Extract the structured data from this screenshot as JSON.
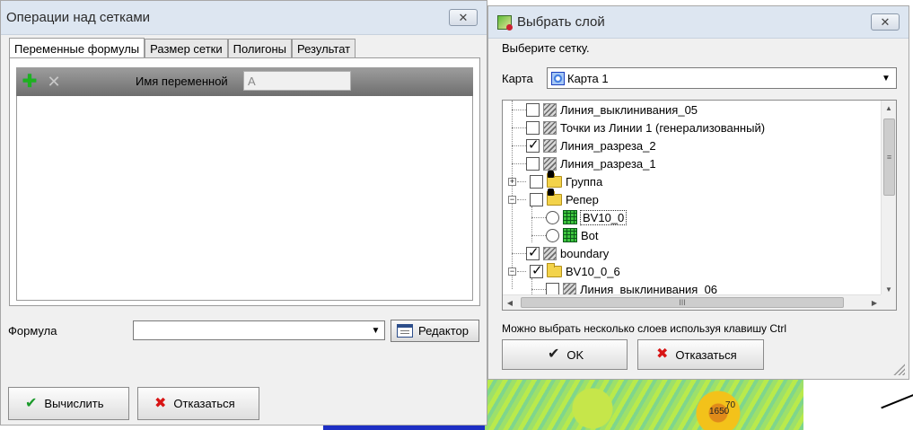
{
  "grid_window": {
    "title": "Операции над сетками",
    "close_label": "✕",
    "tabs": [
      {
        "label": "Переменные формулы"
      },
      {
        "label": "Размер сетки"
      },
      {
        "label": "Полигоны"
      },
      {
        "label": "Результат"
      }
    ],
    "variable_label": "Имя переменной",
    "variable_value": "A",
    "formula_label": "Формула",
    "formula_value": "",
    "editor_button": "Редактор",
    "calculate_button": "Вычислить",
    "cancel_button": "Отказаться"
  },
  "layer_window": {
    "title": "Выбрать слой",
    "close_label": "✕",
    "hint": "Выберите сетку.",
    "map_label": "Карта",
    "map_value": "Карта 1",
    "tree": [
      {
        "label": "Линия_выклинивания_05",
        "checked": false
      },
      {
        "label": "Точки из Линии 1 (генерализованный)",
        "checked": false
      },
      {
        "label": "Линия_разреза_2",
        "checked": true
      },
      {
        "label": "Линия_разреза_1",
        "checked": false
      },
      {
        "label": "Группа",
        "checked": false
      },
      {
        "label": "Репер",
        "checked": false
      },
      {
        "label": "BV10_0",
        "checked": false
      },
      {
        "label": "Bot",
        "checked": false
      },
      {
        "label": "boundary",
        "checked": true
      },
      {
        "label": "BV10_0_6",
        "checked": true
      },
      {
        "label": "Линия_выклинивания_06",
        "checked": false
      }
    ],
    "footer_hint": "Можно выбрать несколько слоев используя клавишу Ctrl",
    "ok_button": "OK",
    "cancel_button": "Отказаться"
  },
  "background": {
    "contour_label": "1650",
    "contour_label_2": "70"
  }
}
